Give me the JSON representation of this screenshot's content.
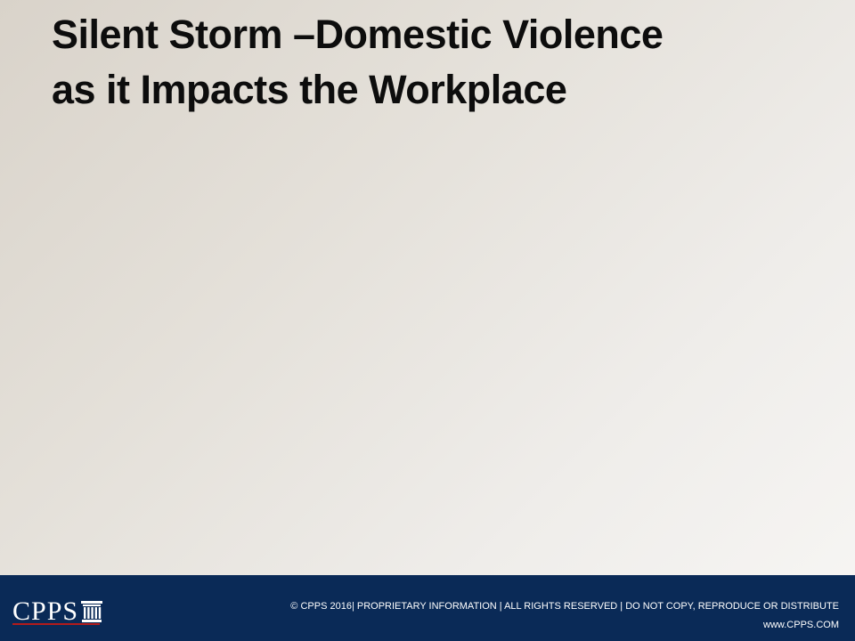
{
  "slide": {
    "title_line1": "Silent Storm –Domestic Violence",
    "title_line2": "as it Impacts the Workplace"
  },
  "footer": {
    "logo_text": "CPPS",
    "logo_icon": "pillar-icon",
    "copyright": "© CPPS 2016| PROPRIETARY INFORMATION | ALL RIGHTS RESERVED | DO NOT COPY, REPRODUCE OR DISTRIBUTE",
    "website": "www.CPPS.COM"
  },
  "colors": {
    "footer_bg": "#0a2a57",
    "logo_accent": "#b31b1b",
    "title_text": "#0d0d0d"
  }
}
